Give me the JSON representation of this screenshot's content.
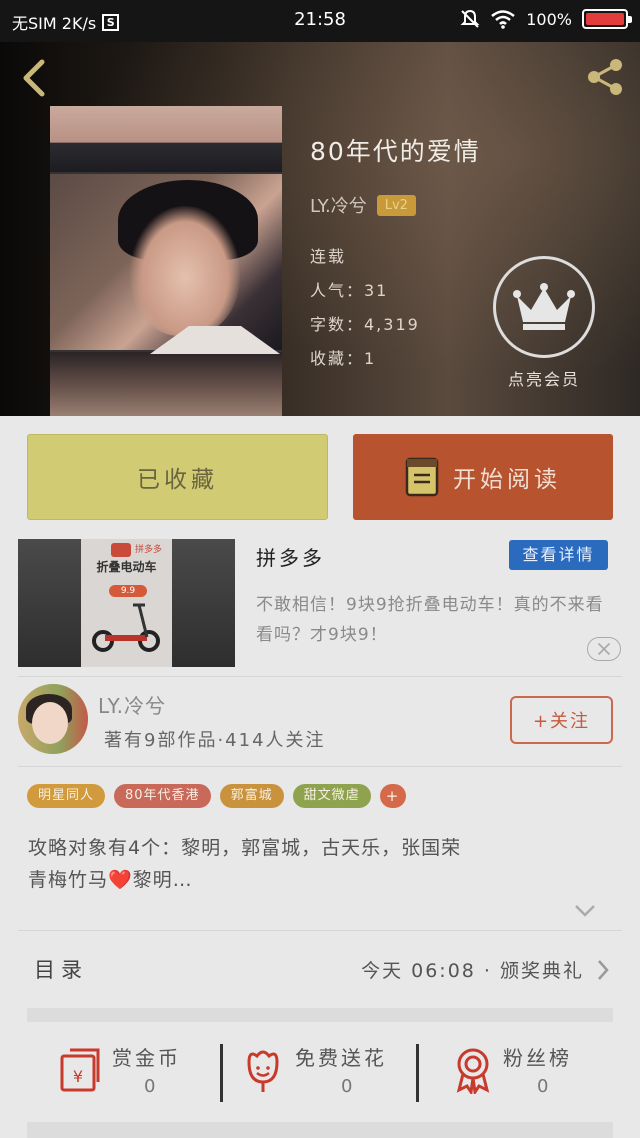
{
  "status_bar": {
    "carrier": "无SIM 2K/s",
    "s_badge": "S",
    "time": "21:58",
    "battery": "100%"
  },
  "book": {
    "title": "80年代的爱情",
    "author": "LY.冷兮",
    "level": "Lv2",
    "status": "连载",
    "popularity": "人气：31",
    "word_count": "字数：4,319",
    "favorites": "收藏：1"
  },
  "vip": {
    "label": "点亮会员"
  },
  "actions": {
    "favorited_label": "已收藏",
    "read_label": "开始阅读"
  },
  "ad": {
    "image_logo": "拼多多",
    "image_headline": "折叠电动车",
    "image_price": "9.9",
    "title": "拼多多",
    "detail_label": "查看详情",
    "description": "不敢相信！9块9抢折叠电动车！真的不来看看吗？才9块9！"
  },
  "author_card": {
    "name": "LY.冷兮",
    "stats": "著有9部作品·414人关注",
    "follow_label": "+关注"
  },
  "tags": [
    {
      "label": "明星同人",
      "color": "#d19a3c"
    },
    {
      "label": "80年代香港",
      "color": "#c8695a"
    },
    {
      "label": "郭富城",
      "color": "#c9923c"
    },
    {
      "label": "甜文微虐",
      "color": "#8fa34e"
    },
    {
      "label": "+",
      "color": "#d56a4a"
    }
  ],
  "description": {
    "line1": "攻略对象有4个：黎明，郭富城，古天乐，张国荣",
    "line2": "青梅竹马❤️黎明…"
  },
  "toc": {
    "label": "目录",
    "latest": "今天 06:08 · 颁奖典礼"
  },
  "stats": [
    {
      "label": "赏金币",
      "value": "0",
      "icon": "red-envelope-icon"
    },
    {
      "label": "免费送花",
      "value": "0",
      "icon": "flower-icon"
    },
    {
      "label": "粉丝榜",
      "value": "0",
      "icon": "medal-icon"
    }
  ],
  "colors": {
    "accent_red": "#b7532e",
    "favorite_yellow": "#d1cc74",
    "link_blue": "#2b6bbd"
  }
}
